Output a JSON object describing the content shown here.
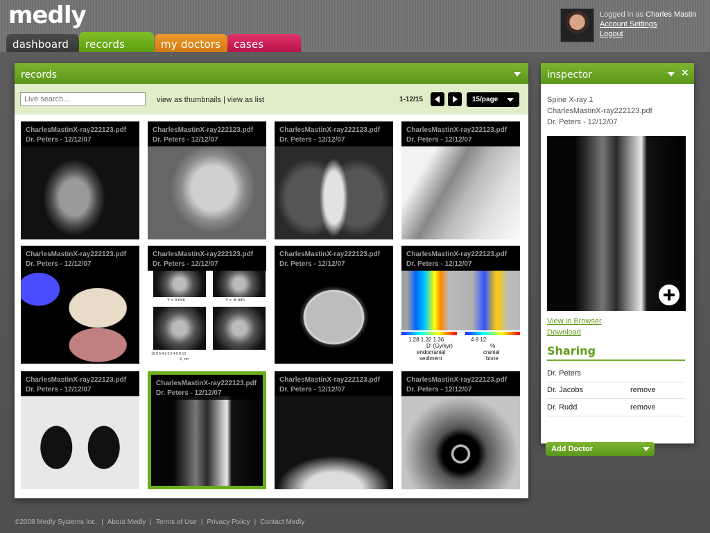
{
  "app": {
    "logo": "medly"
  },
  "nav": {
    "tabs": [
      {
        "label": "dashboard"
      },
      {
        "label": "records"
      },
      {
        "label": "my doctors"
      },
      {
        "label": "cases"
      }
    ]
  },
  "user": {
    "logged_in_prefix": "Logged in as",
    "name": "Charles Mastin",
    "account_settings": "Account Settings",
    "logout": "Logout"
  },
  "records": {
    "title": "records",
    "search_placeholder": "Live search...",
    "view_thumbnails": "view as thumbnails",
    "view_separator": "|",
    "view_list": "view as list",
    "range": "1-12/15",
    "per_page": "15/page",
    "items": [
      {
        "file": "CharlesMastinX-ray222123.pdf",
        "doctor": "Dr. Peters - 12/12/07",
        "image": "mri-head"
      },
      {
        "file": "CharlesMastinX-ray222123.pdf",
        "doctor": "Dr. Peters - 12/12/07",
        "image": "skull-xray"
      },
      {
        "file": "CharlesMastinX-ray222123.pdf",
        "doctor": "Dr. Peters - 12/12/07",
        "image": "chest-xray"
      },
      {
        "file": "CharlesMastinX-ray222123.pdf",
        "doctor": "Dr. Peters - 12/12/07",
        "image": "shoulder-xray"
      },
      {
        "file": "CharlesMastinX-ray222123.pdf",
        "doctor": "Dr. Peters - 12/12/07",
        "image": "brain-3d"
      },
      {
        "file": "CharlesMastinX-ray222123.pdf",
        "doctor": "Dr. Peters - 12/12/07",
        "image": "scan-panels"
      },
      {
        "file": "CharlesMastinX-ray222123.pdf",
        "doctor": "Dr. Peters - 12/12/07",
        "image": "brain-axial-mri"
      },
      {
        "file": "CharlesMastinX-ray222123.pdf",
        "doctor": "Dr. Peters - 12/12/07",
        "image": "heat-map"
      },
      {
        "file": "CharlesMastinX-ray222123.pdf",
        "doctor": "Dr. Peters - 12/12/07",
        "image": "lung-ct"
      },
      {
        "file": "CharlesMastinX-ray222123.pdf",
        "doctor": "Dr. Peters - 12/12/07",
        "image": "spine-mri",
        "selected": true
      },
      {
        "file": "CharlesMastinX-ray222123.pdf",
        "doctor": "Dr. Peters - 12/12/07",
        "image": "mammogram"
      },
      {
        "file": "CharlesMastinX-ray222123.pdf",
        "doctor": "Dr. Peters - 12/12/07",
        "image": "ultrasound"
      }
    ],
    "scan_labels": {
      "top_left": "Y = 0 mm",
      "top_right": "Y = -6 mm",
      "axis": "10 8 6 4 2 0 2 4 6 8 10",
      "axis_unit": "X, cm"
    },
    "heat_labels": {
      "left_ticks": "1.28   1.32   1.36",
      "left_unit": "D' (Gy/kyr)",
      "left_caption_1": "endocranial",
      "left_caption_2": "sediment",
      "right_ticks": "4      8      12",
      "right_unit": "%",
      "right_caption_1": "cranial",
      "right_caption_2": "bone"
    }
  },
  "inspector": {
    "title": "inspector",
    "file_type": "Spine X-ray 1",
    "file_name": "CharlesMastinX-ray222123.pdf",
    "doctor": "Dr. Peters - 12/12/07",
    "view_in_browser": "View in Browser",
    "download": "Download",
    "sharing_title": "Sharing",
    "sharing": [
      {
        "name": "Dr. Peters",
        "action": ""
      },
      {
        "name": "Dr. Jacobs",
        "action": "remove"
      },
      {
        "name": "Dr. Rudd",
        "action": "remove"
      }
    ],
    "add_doctor": "Add Doctor"
  },
  "footer": {
    "links": [
      "©2008 Medly Systems Inc.",
      "About Medly",
      "Terms of Use",
      "Privacy Policy",
      "Contact Medly"
    ],
    "separator": "|"
  },
  "colors": {
    "brand_green": "#6fab28",
    "tab_dashboard": "#3a3a3a",
    "tab_records": "#6fad1c",
    "tab_doctors": "#e08a1e",
    "tab_cases": "#c81e56"
  }
}
